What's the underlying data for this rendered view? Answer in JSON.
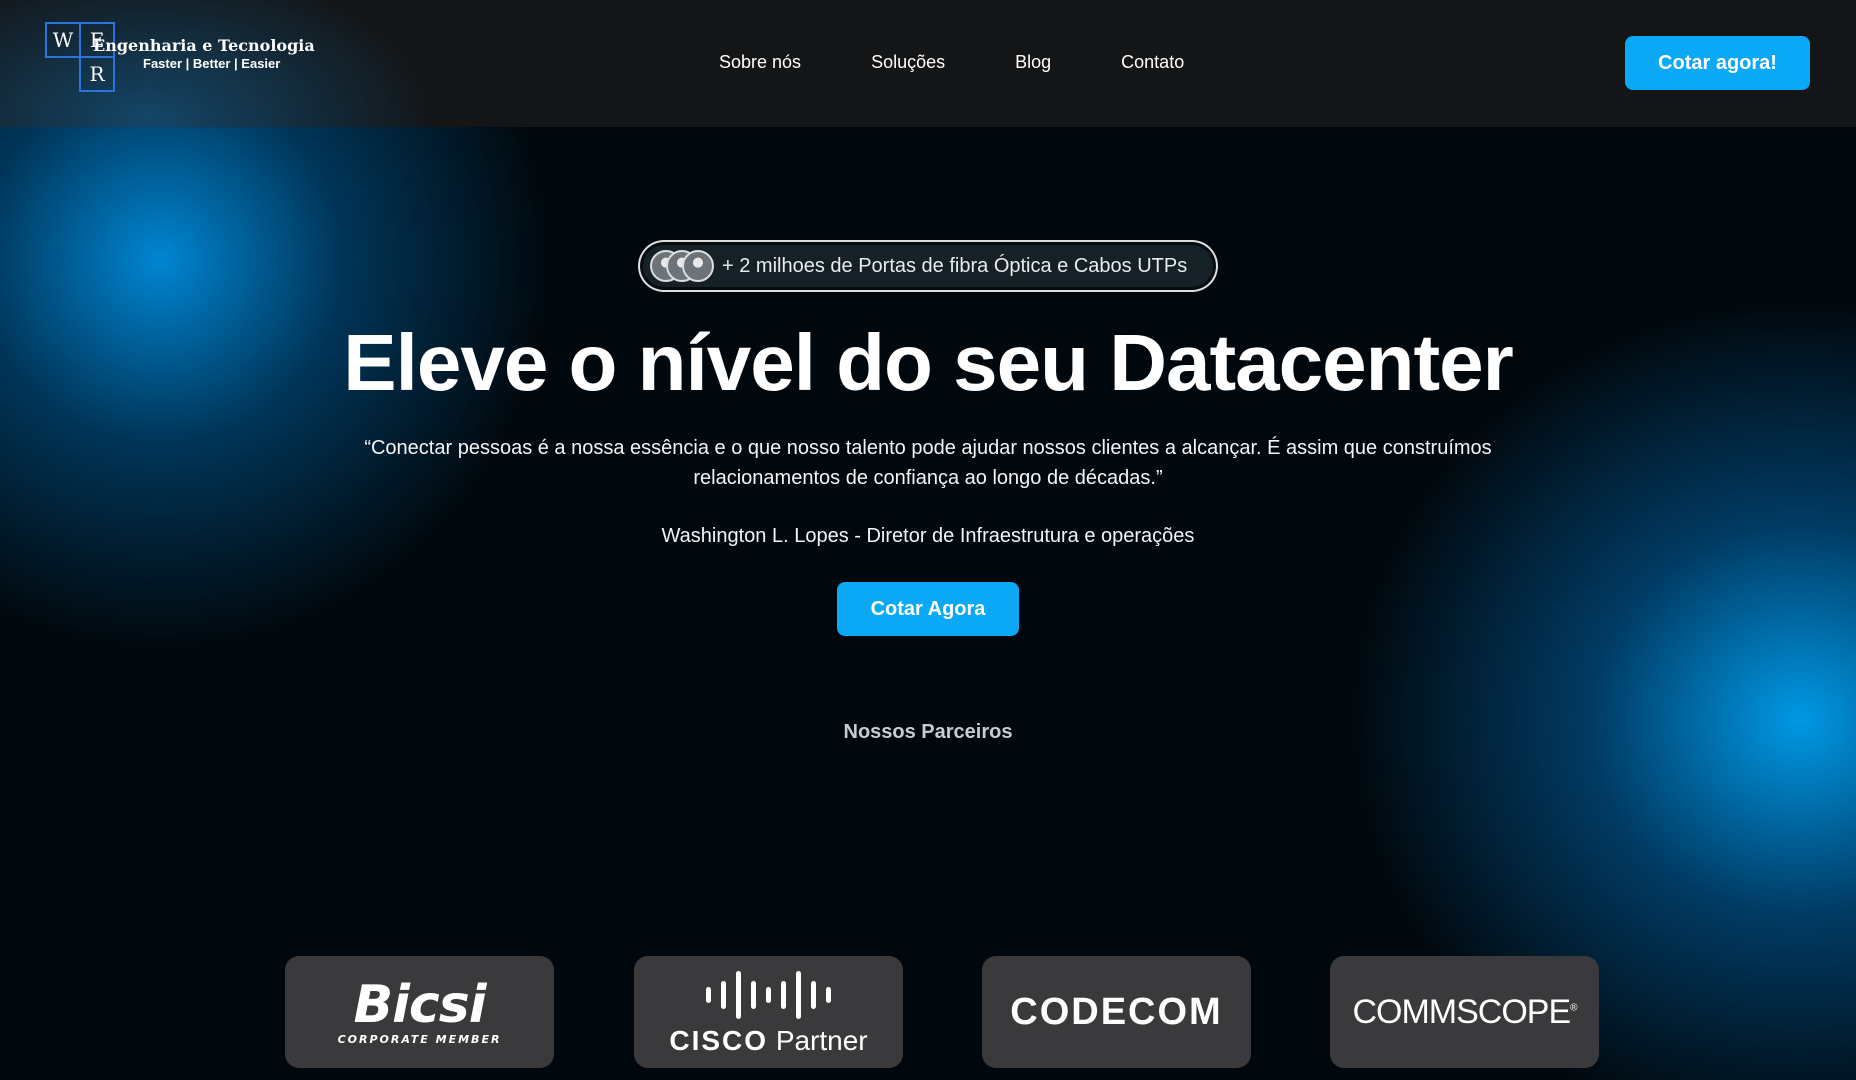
{
  "header": {
    "logo": {
      "letters": [
        "W",
        "E",
        "R"
      ],
      "title": "Engenharia e Tecnologia",
      "tagline": "Faster | Better | Easier"
    },
    "nav": [
      {
        "label": "Sobre nós"
      },
      {
        "label": "Soluções"
      },
      {
        "label": "Blog"
      },
      {
        "label": "Contato"
      }
    ],
    "cta_label": "Cotar agora!"
  },
  "hero": {
    "pill_text": "+ 2 milhoes de Portas de fibra Óptica e Cabos UTPs",
    "title": "Eleve o nível do seu Datacenter",
    "quote": "“Conectar pessoas é a nossa essência e o que nosso talento pode ajudar nossos clientes a alcançar. É assim que construímos relacionamentos de confiança ao longo de décadas.”",
    "author": "Washington L. Lopes - Diretor de Infraestrutura e operações",
    "cta_label": "Cotar Agora"
  },
  "partners": {
    "heading": "Nossos Parceiros",
    "items": [
      {
        "name": "Bicsi",
        "sub": "CORPORATE MEMBER"
      },
      {
        "name": "CISCO",
        "sub": "Partner"
      },
      {
        "name": "CODECOM"
      },
      {
        "name": "COMMSCOPE"
      }
    ]
  },
  "colors": {
    "accent": "#0aa8f5",
    "header_bg": "#131517",
    "card_bg": "#3a3a3c",
    "logo_blue": "#2b74e0"
  }
}
